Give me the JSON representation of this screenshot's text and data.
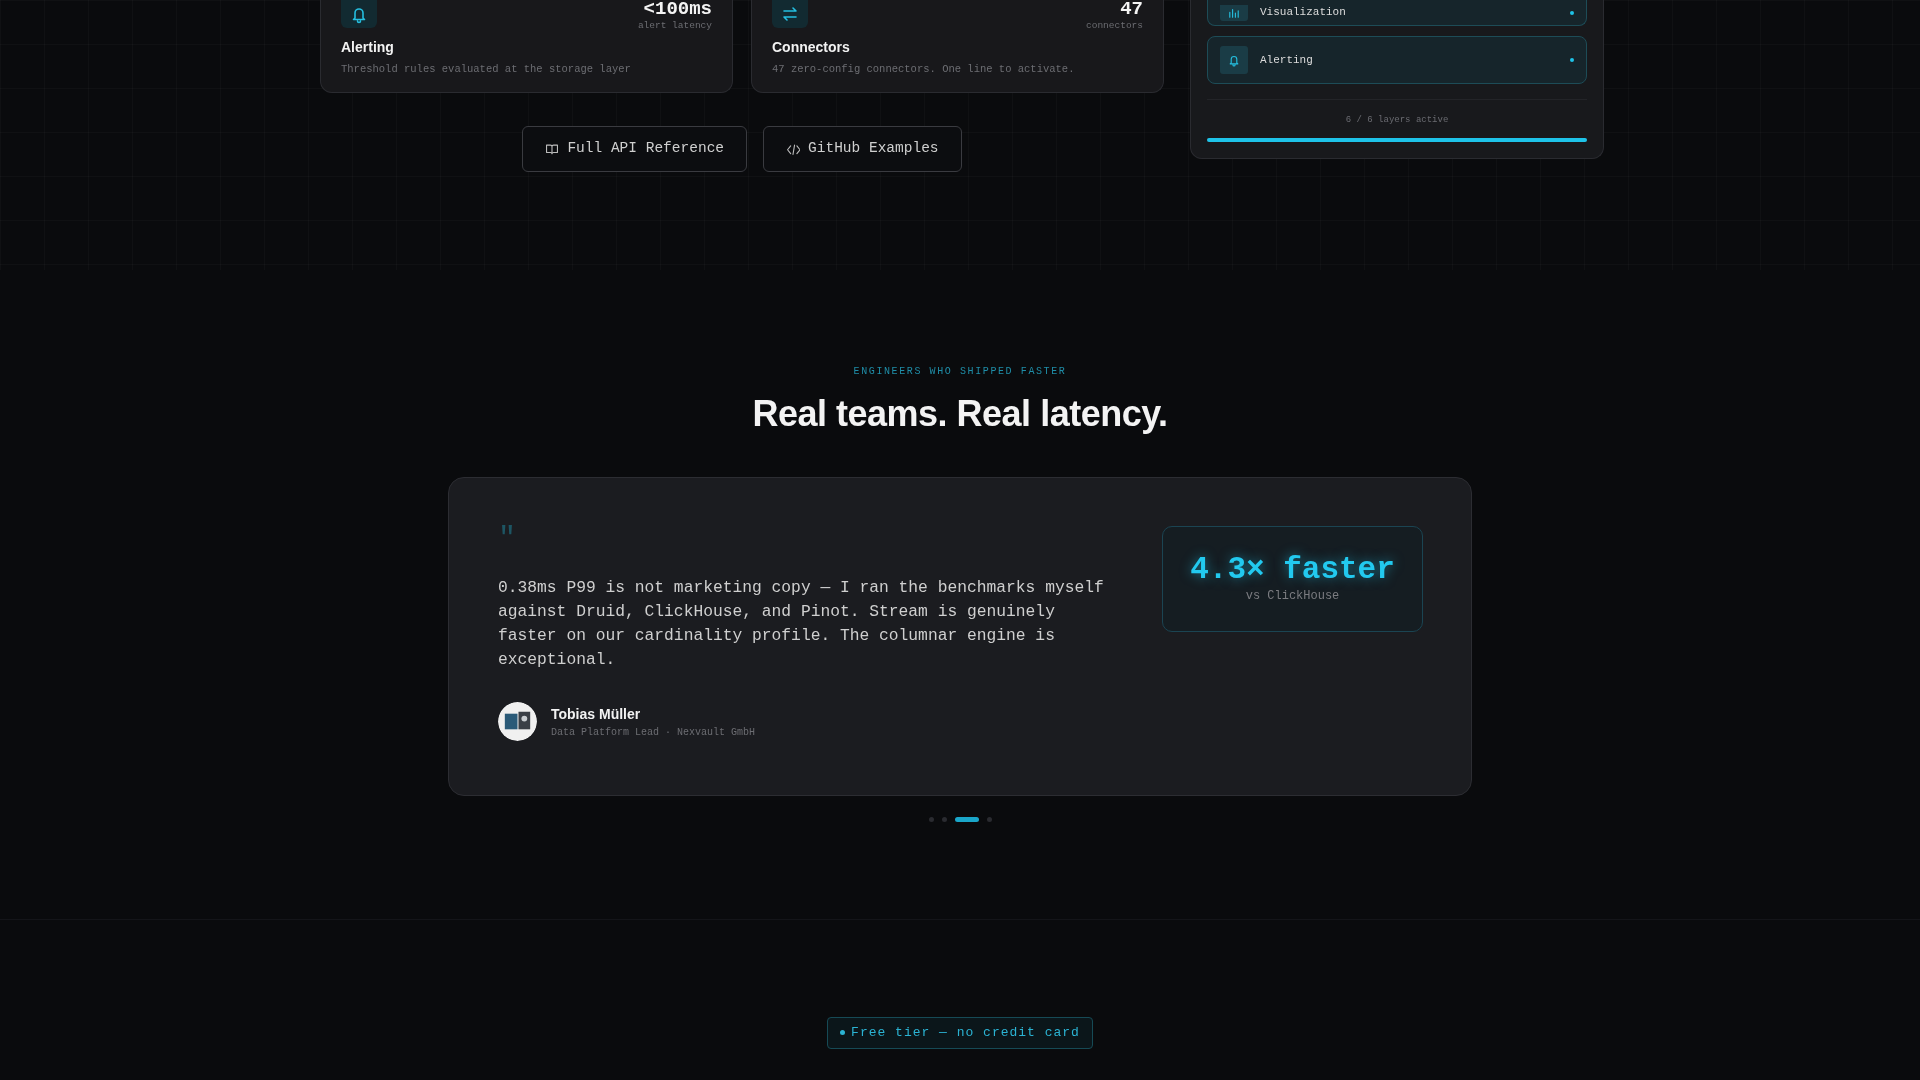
{
  "feature_cards": [
    {
      "title": "Alerting",
      "description": "Threshold rules evaluated at the storage layer",
      "metric": "<100ms",
      "metric_label": "alert latency"
    },
    {
      "title": "Connectors",
      "description": "47 zero-config connectors. One line to activate.",
      "metric": "47",
      "metric_label": "connectors"
    }
  ],
  "buttons": [
    "Full API Reference",
    "GitHub Examples"
  ],
  "layers_panel": {
    "layers": [
      {
        "label": "Visualization",
        "active": true
      },
      {
        "label": "Alerting",
        "active": true
      }
    ],
    "status": "6 / 6 layers active",
    "progress": {
      "level": 1
    }
  },
  "testimonials": {
    "eyebrow": "ENGINEERS WHO SHIPPED FASTER",
    "heading": "Real teams. Real latency.",
    "quote_mark": "\"",
    "quote": "0.38ms P99 is not marketing copy — I ran the benchmarks myself against Druid, ClickHouse, and Pinot. Stream is genuinely faster on our cardinality profile. The columnar engine is exceptional.",
    "author": {
      "name": "Tobias Müller",
      "role": "Data Platform Lead · Nexvault GmbH"
    },
    "stat": {
      "value": "4.3× faster",
      "label": "vs ClickHouse"
    },
    "dots": [
      {
        "selected": false
      },
      {
        "selected": false
      },
      {
        "selected": true
      },
      {
        "selected": false
      }
    ]
  },
  "cta": {
    "badge": "Free tier — no credit card"
  }
}
